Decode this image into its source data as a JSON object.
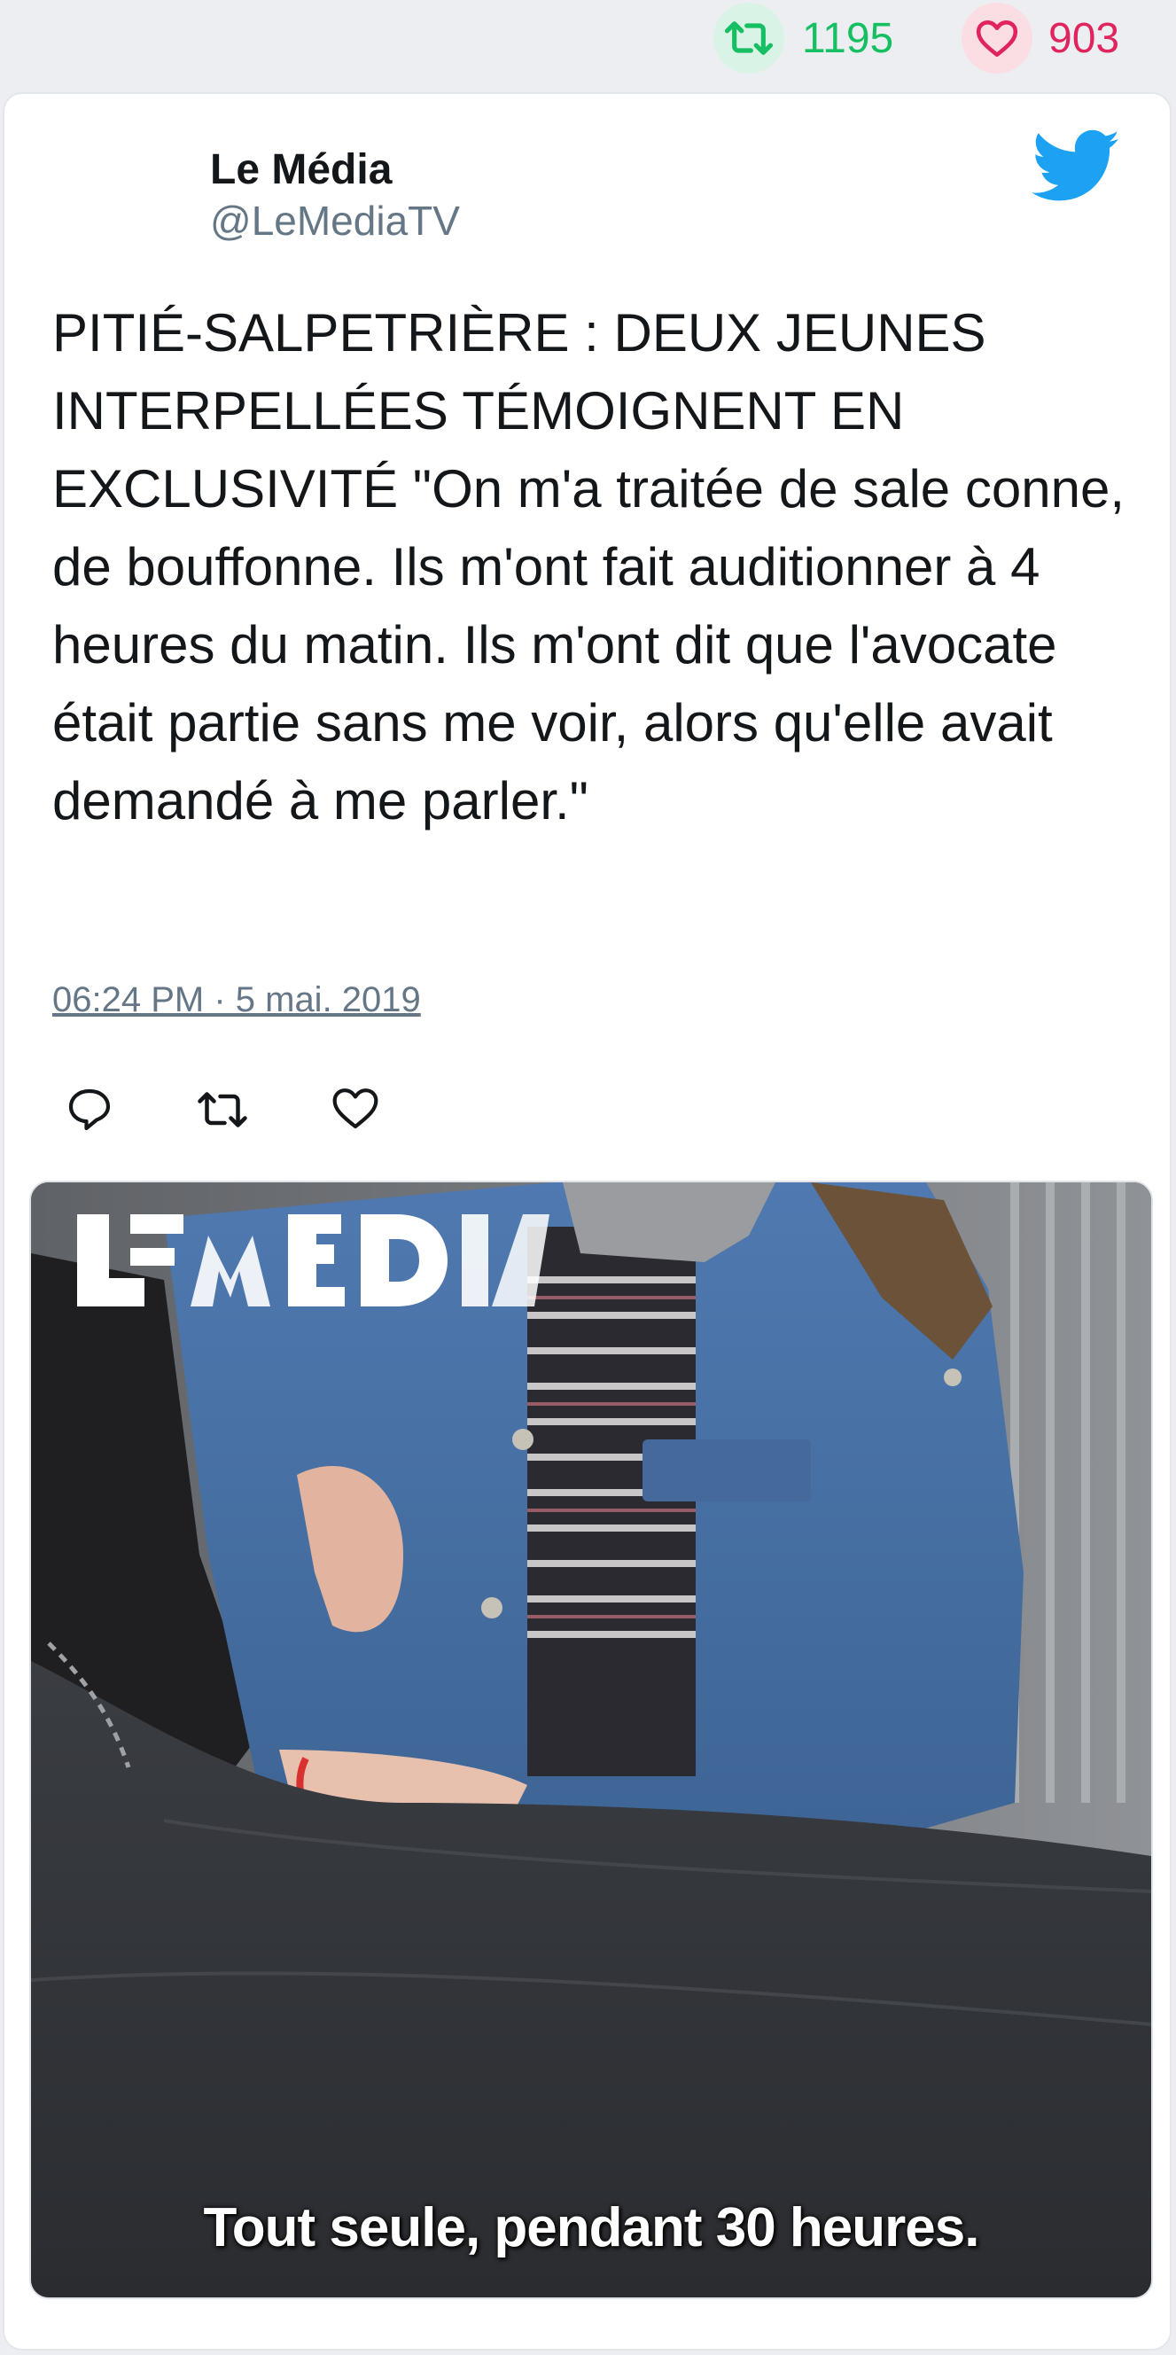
{
  "stats": {
    "retweet_count": "1195",
    "like_count": "903"
  },
  "tweet": {
    "author_name": "Le Média",
    "author_handle": "@LeMediaTV",
    "text": "PITIÉ-SALPETRIÈRE : DEUX JEUNES INTERPELLÉES TÉMOIGNENT EN EXCLUSIVITÉ \"On m'a traitée de sale conne, de bouffonne. Ils m'ont fait auditionner à 4 heures du matin. Ils m'ont dit que l'avocate était partie sans me voir, alors qu'elle avait demandé à me parler.\"",
    "timestamp": "06:24 PM · 5 mai. 2019"
  },
  "media": {
    "logo_text": "LE MEDIA",
    "caption": "Tout seule, pendant 30 heures."
  },
  "icons": {
    "retweet": "retweet-icon",
    "like": "heart-icon",
    "reply": "reply-icon",
    "brand": "twitter-bird-icon"
  },
  "colors": {
    "retweet_green": "#17bf63",
    "like_red": "#e0245e",
    "twitter_blue": "#1da1f2",
    "handle_gray": "#657786"
  }
}
